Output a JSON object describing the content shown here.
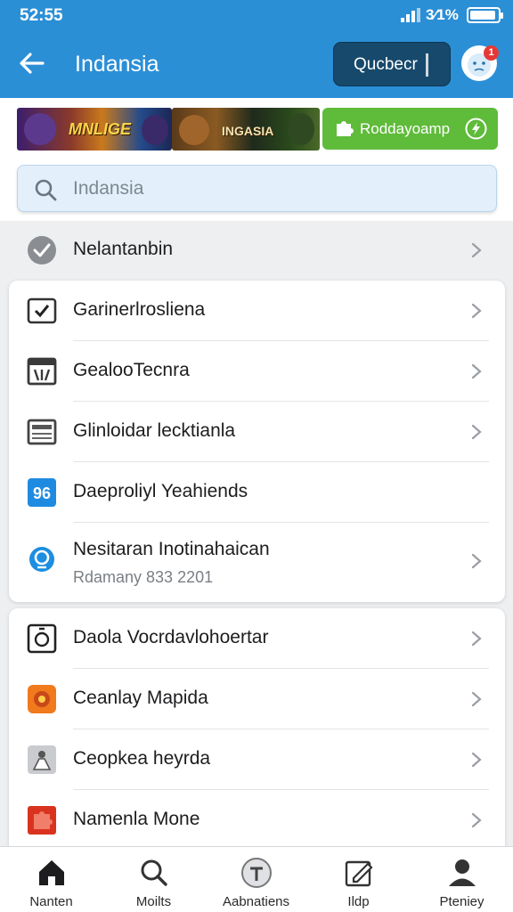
{
  "status_bar": {
    "time": "52:55",
    "battery_text": "3⁄1%"
  },
  "header": {
    "title": "Indansia",
    "button_label": "Qucbecr",
    "badge_count": "1"
  },
  "banners": [
    {
      "text": "MNLIGE"
    },
    {
      "text": "INGASIA"
    },
    {
      "text": "Roddayoamp"
    }
  ],
  "search": {
    "placeholder": "Indansia"
  },
  "top_row": {
    "label": "Nelantanbin"
  },
  "group1": [
    {
      "label": "Garinerlrosliena",
      "icon": "checkbox-icon"
    },
    {
      "label": "GealooTecnra",
      "icon": "calendar-icon"
    },
    {
      "label": "Glinloidar lecktianla",
      "icon": "screen-icon"
    },
    {
      "label": "Daeproliyl Yeahiends",
      "icon": "app-blue-icon"
    },
    {
      "label": "Nesitaran Inotinahaican",
      "sublabel": "Rdamany 833 2201",
      "icon": "location-icon"
    }
  ],
  "group2": [
    {
      "label": "Daola Vocrdavlohoertar",
      "icon": "device-icon"
    },
    {
      "label": "Ceanlay Mapida",
      "icon": "map-orange-icon"
    },
    {
      "label": "Ceopkea heyrda",
      "icon": "person-gray-icon"
    },
    {
      "label": "Namenla Mone",
      "icon": "puzzle-red-icon"
    }
  ],
  "bottom_nav": [
    {
      "label": "Nanten",
      "icon": "home-icon"
    },
    {
      "label": "Moilts",
      "icon": "search-icon"
    },
    {
      "label": "Aabnatiens",
      "icon": "settings-circle-icon"
    },
    {
      "label": "Ildp",
      "icon": "edit-icon"
    },
    {
      "label": "Pteniey",
      "icon": "profile-icon"
    }
  ],
  "colors": {
    "header": "#2b8fd6",
    "header_button": "#17496c",
    "accent_green": "#5fbb3a",
    "badge": "#e53935"
  }
}
